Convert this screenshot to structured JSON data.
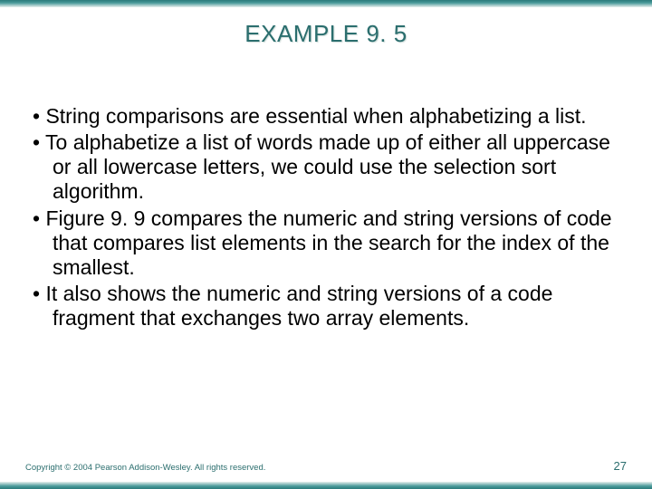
{
  "title": "EXAMPLE 9. 5",
  "bullets": [
    "String comparisons are essential when alphabetizing a list.",
    "To alphabetize a list of words made up of either all uppercase or all lowercase letters, we could use the selection sort algorithm.",
    "Figure 9. 9 compares the numeric and string versions of code that compares list elements in the search for the index of the smallest.",
    "It also shows the numeric and string versions of a code fragment that exchanges two array elements."
  ],
  "footer": {
    "copyright": "Copyright © 2004 Pearson Addison-Wesley. All rights reserved.",
    "page": "27"
  }
}
